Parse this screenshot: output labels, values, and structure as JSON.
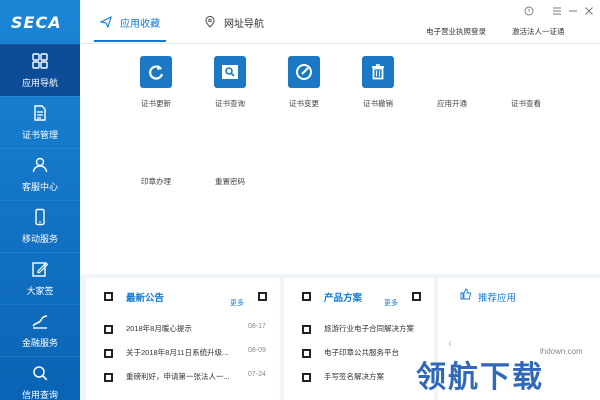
{
  "app": {
    "logo_text": "SECA"
  },
  "sidebar": {
    "items": [
      {
        "label": "应用导航",
        "icon": "apps-icon",
        "active": true
      },
      {
        "label": "证书管理",
        "icon": "document-icon",
        "active": false
      },
      {
        "label": "客服中心",
        "icon": "user-icon",
        "active": false
      },
      {
        "label": "移动服务",
        "icon": "phone-icon",
        "active": false
      },
      {
        "label": "大家签",
        "icon": "edit-icon",
        "active": false
      },
      {
        "label": "金融服务",
        "icon": "finance-icon",
        "active": false
      },
      {
        "label": "信用查询",
        "icon": "search-icon",
        "active": false
      }
    ]
  },
  "header": {
    "tabs": [
      {
        "label": "应用收藏",
        "icon": "send-icon",
        "active": true
      },
      {
        "label": "网址导航",
        "icon": "location-icon",
        "active": false
      }
    ],
    "links": [
      "电子营业执照登录",
      "激活法人一证通"
    ]
  },
  "apps": [
    {
      "label": "证书更新",
      "icon": "refresh-icon"
    },
    {
      "label": "证书查询",
      "icon": "query-icon"
    },
    {
      "label": "证书变更",
      "icon": "change-icon"
    },
    {
      "label": "证书撤销",
      "icon": "trash-icon"
    },
    {
      "label": "应用开通",
      "icon": ""
    },
    {
      "label": "证书查看",
      "icon": ""
    },
    {
      "label": "印章办理",
      "icon": ""
    },
    {
      "label": "重置密码",
      "icon": ""
    }
  ],
  "announcements": {
    "title": "最新公告",
    "more": "更多",
    "items": [
      {
        "text": "2018年8月暖心提示",
        "date": "08-17"
      },
      {
        "text": "关于2018年8月11日系统升级...",
        "date": "08-09"
      },
      {
        "text": "重磅利好，申请第一张法人一...",
        "date": "07-24"
      }
    ]
  },
  "solutions": {
    "title": "产品方案",
    "more": "更多",
    "items": [
      {
        "text": "旅游行业电子合同解决方案"
      },
      {
        "text": "电子印章公共服务平台"
      },
      {
        "text": "手写签名解决方案"
      }
    ]
  },
  "recommend": {
    "title": "推荐应用"
  },
  "watermark": {
    "site": "lhdown.com",
    "text": "领航下载"
  },
  "colors": {
    "sidebar": "#0a63b4",
    "accent": "#1479cf",
    "tile": "#1a78c4"
  }
}
